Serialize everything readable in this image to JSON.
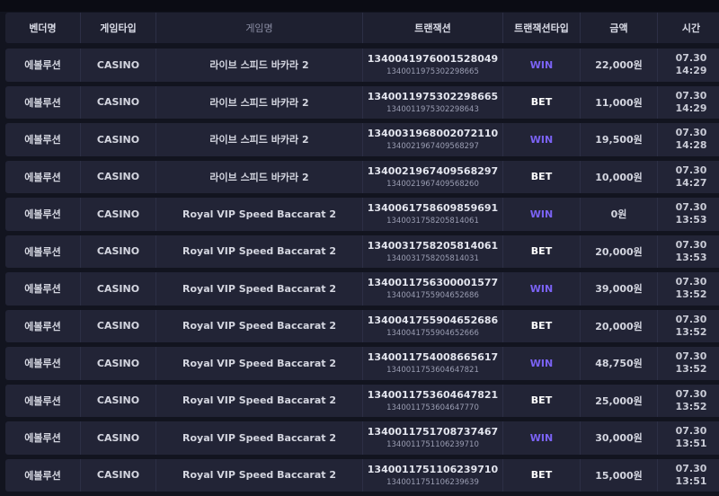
{
  "headers": {
    "vendor": "벤더명",
    "game_type": "게임타입",
    "game_name": "게임명",
    "transaction": "트랜잭션",
    "transaction_type": "트랜잭션타입",
    "amount": "금액",
    "time": "시간"
  },
  "rows": [
    {
      "vendor": "에볼루션",
      "game_type": "CASINO",
      "game_name": "라이브 스피드 바카라 2",
      "tx_main": "1340041976001528049",
      "tx_sub": "1340011975302298665",
      "type": "WIN",
      "amount": "22,000원",
      "date": "07.30",
      "time": "14:29"
    },
    {
      "vendor": "에볼루션",
      "game_type": "CASINO",
      "game_name": "라이브 스피드 바카라 2",
      "tx_main": "1340011975302298665",
      "tx_sub": "1340011975302298643",
      "type": "BET",
      "amount": "11,000원",
      "date": "07.30",
      "time": "14:29"
    },
    {
      "vendor": "에볼루션",
      "game_type": "CASINO",
      "game_name": "라이브 스피드 바카라 2",
      "tx_main": "1340031968002072110",
      "tx_sub": "1340021967409568297",
      "type": "WIN",
      "amount": "19,500원",
      "date": "07.30",
      "time": "14:28"
    },
    {
      "vendor": "에볼루션",
      "game_type": "CASINO",
      "game_name": "라이브 스피드 바카라 2",
      "tx_main": "1340021967409568297",
      "tx_sub": "1340021967409568260",
      "type": "BET",
      "amount": "10,000원",
      "date": "07.30",
      "time": "14:27"
    },
    {
      "vendor": "에볼루션",
      "game_type": "CASINO",
      "game_name": "Royal VIP Speed Baccarat 2",
      "tx_main": "1340061758609859691",
      "tx_sub": "1340031758205814061",
      "type": "WIN",
      "amount": "0원",
      "date": "07.30",
      "time": "13:53"
    },
    {
      "vendor": "에볼루션",
      "game_type": "CASINO",
      "game_name": "Royal VIP Speed Baccarat 2",
      "tx_main": "1340031758205814061",
      "tx_sub": "1340031758205814031",
      "type": "BET",
      "amount": "20,000원",
      "date": "07.30",
      "time": "13:53"
    },
    {
      "vendor": "에볼루션",
      "game_type": "CASINO",
      "game_name": "Royal VIP Speed Baccarat 2",
      "tx_main": "1340011756300001577",
      "tx_sub": "1340041755904652686",
      "type": "WIN",
      "amount": "39,000원",
      "date": "07.30",
      "time": "13:52"
    },
    {
      "vendor": "에볼루션",
      "game_type": "CASINO",
      "game_name": "Royal VIP Speed Baccarat 2",
      "tx_main": "1340041755904652686",
      "tx_sub": "1340041755904652666",
      "type": "BET",
      "amount": "20,000원",
      "date": "07.30",
      "time": "13:52"
    },
    {
      "vendor": "에볼루션",
      "game_type": "CASINO",
      "game_name": "Royal VIP Speed Baccarat 2",
      "tx_main": "1340011754008665617",
      "tx_sub": "1340011753604647821",
      "type": "WIN",
      "amount": "48,750원",
      "date": "07.30",
      "time": "13:52"
    },
    {
      "vendor": "에볼루션",
      "game_type": "CASINO",
      "game_name": "Royal VIP Speed Baccarat 2",
      "tx_main": "1340011753604647821",
      "tx_sub": "1340011753604647770",
      "type": "BET",
      "amount": "25,000원",
      "date": "07.30",
      "time": "13:52"
    },
    {
      "vendor": "에볼루션",
      "game_type": "CASINO",
      "game_name": "Royal VIP Speed Baccarat 2",
      "tx_main": "1340011751708737467",
      "tx_sub": "1340011751106239710",
      "type": "WIN",
      "amount": "30,000원",
      "date": "07.30",
      "time": "13:51"
    },
    {
      "vendor": "에볼루션",
      "game_type": "CASINO",
      "game_name": "Royal VIP Speed Baccarat 2",
      "tx_main": "1340011751106239710",
      "tx_sub": "1340011751106239639",
      "type": "BET",
      "amount": "15,000원",
      "date": "07.30",
      "time": "13:51"
    }
  ],
  "colors": {
    "win": "#7b63f5",
    "bet": "#ffffff",
    "row_bg": "#222436",
    "page_bg": "#12141f"
  }
}
